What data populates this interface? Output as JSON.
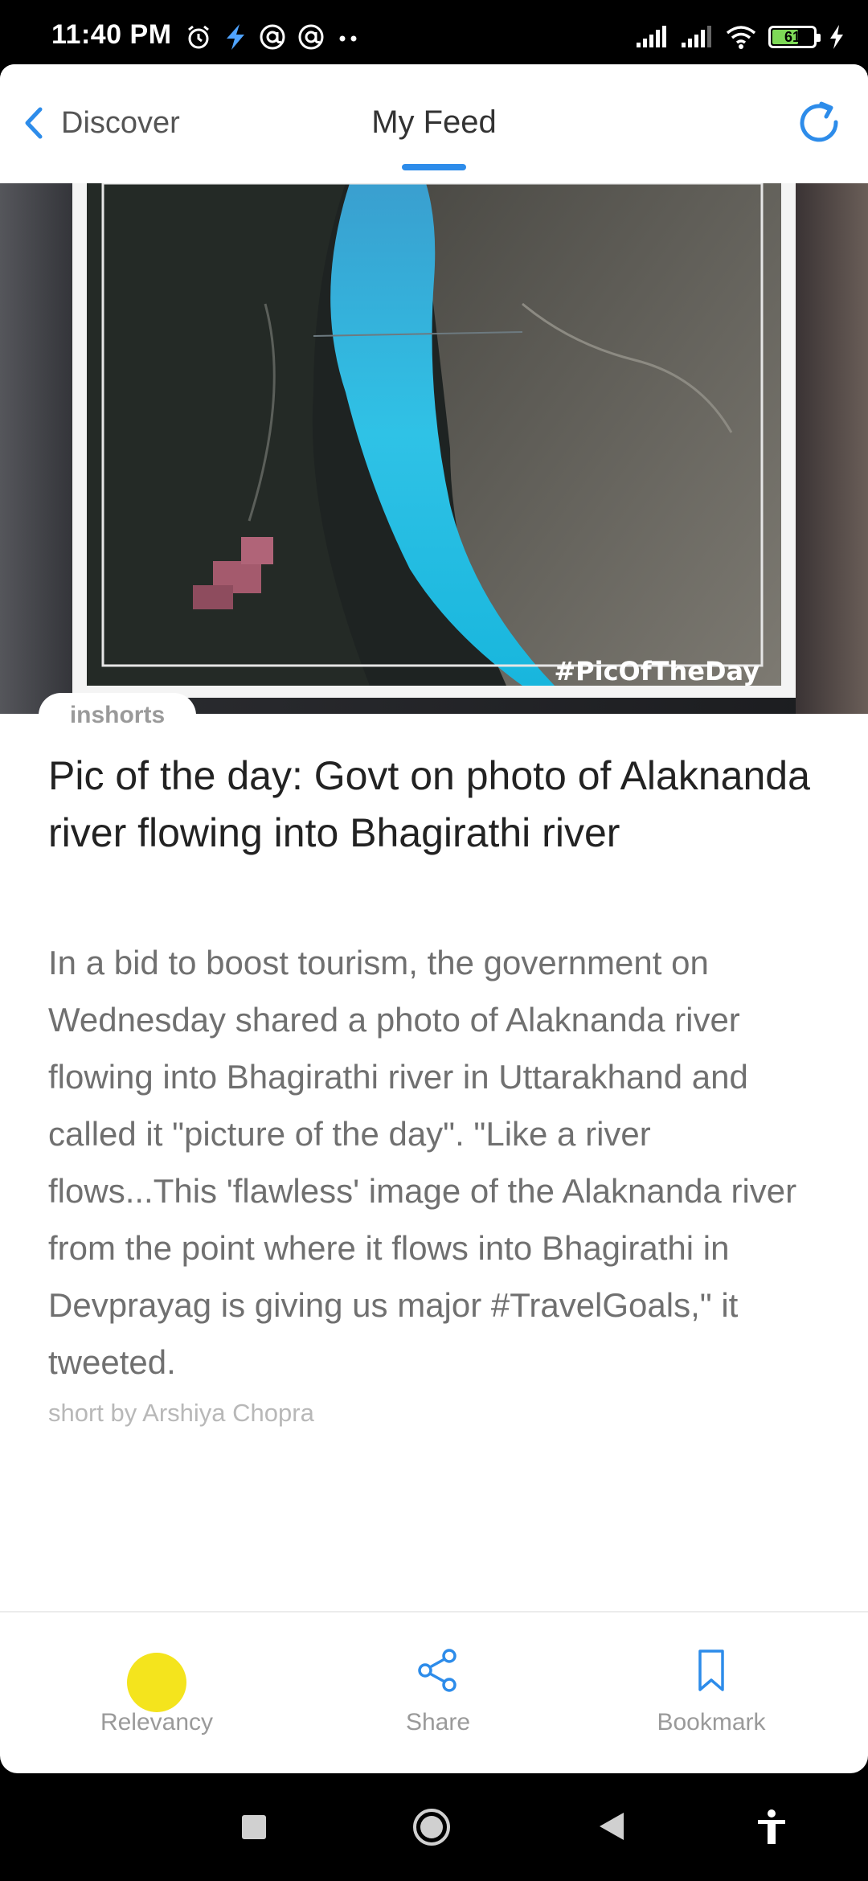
{
  "status_bar": {
    "time": "11:40 PM",
    "battery_level": "61",
    "icons_left": [
      "alarm-icon",
      "bolt-icon",
      "at-sign-icon",
      "at-sign-icon",
      "more-dots-icon"
    ],
    "icons_right": [
      "signal-icon",
      "signal-icon",
      "wifi-icon",
      "battery-icon",
      "charging-icon"
    ]
  },
  "header": {
    "back_label": "Discover",
    "title": "My Feed",
    "accent_color": "#2d8cea"
  },
  "article": {
    "image_caption": "#PicOfTheDay",
    "source": "inshorts",
    "headline": "Pic of the day: Govt on photo of Alaknanda river flowing into Bhagirathi river",
    "body": "In a bid to boost tourism, the government on Wednesday shared a photo of Alaknanda river flowing into Bhagirathi river in Uttarakhand and called it \"picture of the day\". \"Like a river flows...This 'flawless' image of the Alaknanda river from the point where it flows into Bhagirathi in Devprayag is giving us major #TravelGoals,\" it tweeted.",
    "byline": "short by Arshiya Chopra"
  },
  "bottom_nav": {
    "relevancy_label": "Relevancy",
    "relevancy_color": "#f4e41d",
    "share_label": "Share",
    "bookmark_label": "Bookmark"
  }
}
